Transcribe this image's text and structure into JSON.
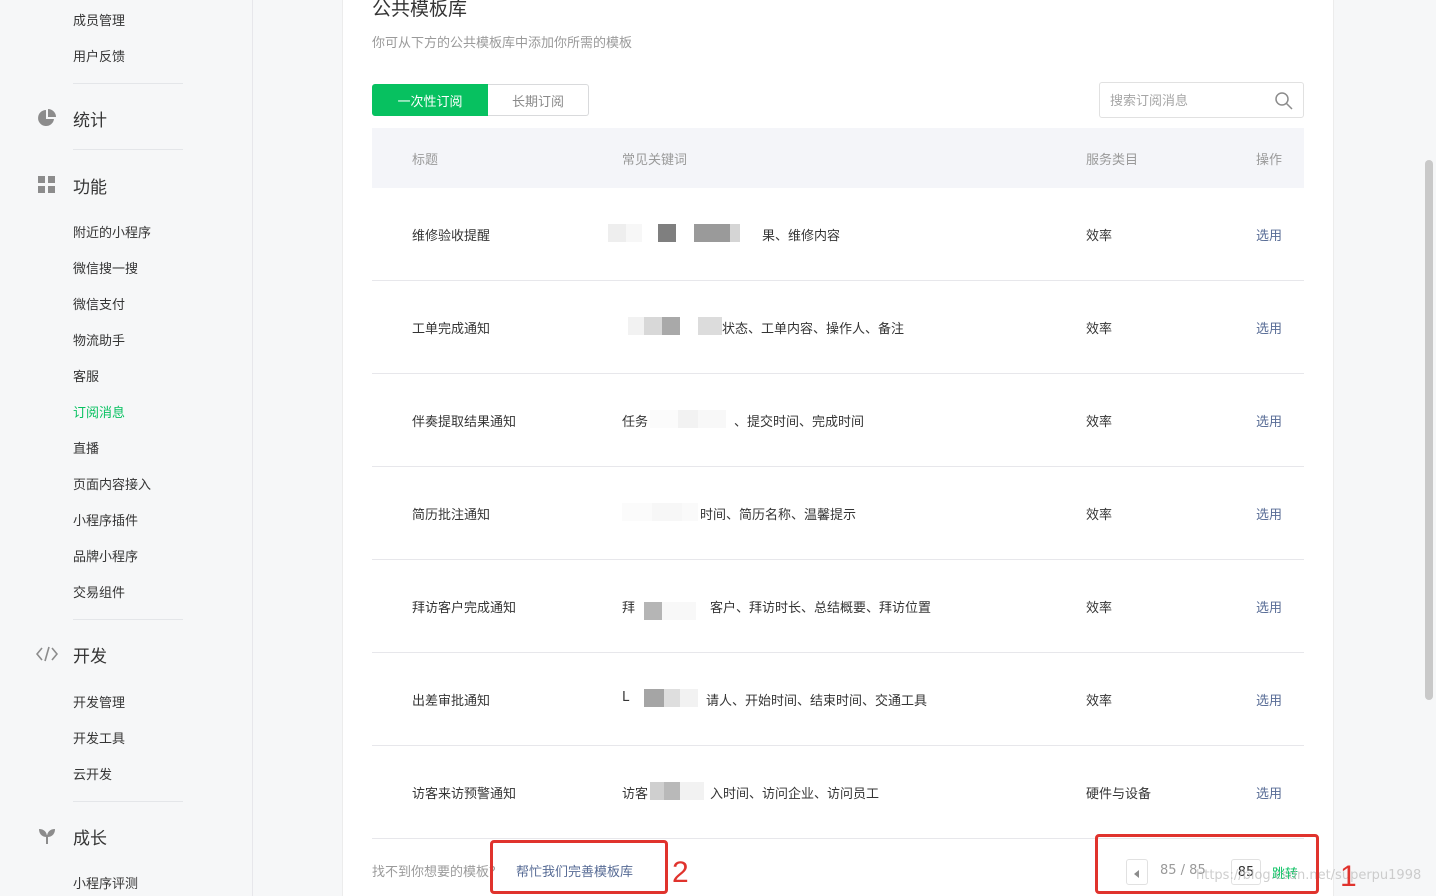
{
  "sidebar": {
    "top_items": [
      {
        "label": "成员管理"
      },
      {
        "label": "用户反馈"
      }
    ],
    "groups": {
      "stats": {
        "label": "统计",
        "icon": "pie-chart-icon"
      },
      "features": {
        "label": "功能",
        "icon": "grid-icon"
      },
      "dev": {
        "label": "开发",
        "icon": "code-icon"
      },
      "growth": {
        "label": "成长",
        "icon": "sprout-icon"
      }
    },
    "feature_items": [
      {
        "label": "附近的小程序"
      },
      {
        "label": "微信搜一搜"
      },
      {
        "label": "微信支付"
      },
      {
        "label": "物流助手"
      },
      {
        "label": "客服"
      },
      {
        "label": "订阅消息",
        "active": true
      },
      {
        "label": "直播"
      },
      {
        "label": "页面内容接入"
      },
      {
        "label": "小程序插件"
      },
      {
        "label": "品牌小程序"
      },
      {
        "label": "交易组件"
      }
    ],
    "dev_items": [
      {
        "label": "开发管理"
      },
      {
        "label": "开发工具"
      },
      {
        "label": "云开发"
      }
    ],
    "growth_items": [
      {
        "label": "小程序评测"
      }
    ]
  },
  "main": {
    "title": "公共模板库",
    "subtitle": "你可从下方的公共模板库中添加你所需的模板",
    "tabs": [
      {
        "label": "一次性订阅",
        "active": true
      },
      {
        "label": "长期订阅",
        "active": false
      }
    ],
    "search": {
      "placeholder": "搜索订阅消息",
      "value": ""
    },
    "table": {
      "headers": {
        "title": "标题",
        "keywords": "常见关键词",
        "category": "服务类目",
        "action": "操作"
      },
      "rows": [
        {
          "title": "维修验收提醒",
          "keywords_visible": "果、维修内容",
          "category": "效率",
          "action": "选用"
        },
        {
          "title": "工单完成通知",
          "keywords_visible": "状态、工单内容、操作人、备注",
          "category": "效率",
          "action": "选用"
        },
        {
          "title": "伴奏提取结果通知",
          "keywords_prefix": "任务",
          "keywords_visible": "、提交时间、完成时间",
          "category": "效率",
          "action": "选用"
        },
        {
          "title": "简历批注通知",
          "keywords_visible": "时间、简历名称、温馨提示",
          "category": "效率",
          "action": "选用"
        },
        {
          "title": "拜访客户完成通知",
          "keywords_prefix": "拜",
          "keywords_visible": "客户、拜访时长、总结概要、拜访位置",
          "category": "效率",
          "action": "选用"
        },
        {
          "title": "出差审批通知",
          "keywords_prefix": "L",
          "keywords_visible": "请人、开始时间、结束时间、交通工具",
          "category": "效率",
          "action": "选用"
        },
        {
          "title": "访客来访预警通知",
          "keywords_prefix": "访客",
          "keywords_visible": "入时间、访问企业、访问员工",
          "category": "硬件与设备",
          "action": "选用"
        }
      ]
    },
    "footer": {
      "note": "找不到你想要的模板？",
      "help_link": "帮忙我们完善模板库"
    },
    "pagination": {
      "current": 85,
      "total": 85,
      "indicator": "85 / 85",
      "input_value": "85",
      "jump_label": "跳转"
    }
  },
  "annotations": {
    "one": "1",
    "two": "2"
  },
  "watermark": "https://blog.csdn.net/superpu1998",
  "colors": {
    "accent_green": "#07c160",
    "link_blue": "#576b95",
    "annotation_red": "#e0332d"
  }
}
